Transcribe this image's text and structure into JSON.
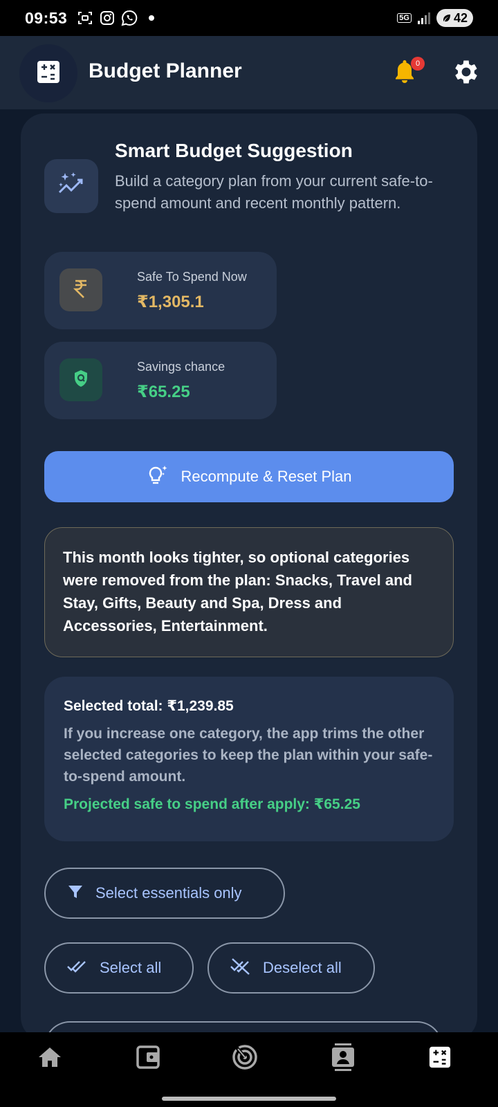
{
  "status_bar": {
    "time": "09:53",
    "network": "5G",
    "battery": "42",
    "icons": [
      "screenshot-icon",
      "instagram-icon",
      "whatsapp-icon",
      "notification-dot",
      "signal-icon",
      "battery-icon"
    ]
  },
  "header": {
    "title": "Budget Planner",
    "notification_count": "0",
    "icons": [
      "calculator-icon",
      "bell-icon",
      "gear-icon"
    ]
  },
  "suggestion": {
    "title": "Smart Budget Suggestion",
    "description": "Build a category plan from your current safe-to-spend amount and recent monthly pattern.",
    "icon": "sparkle-trend-icon"
  },
  "stats": [
    {
      "label": "Safe To Spend Now",
      "value": "₹1,305.1",
      "icon": "rupee-icon",
      "color": "#e3b864"
    },
    {
      "label": "Savings chance",
      "value": "₹65.25",
      "icon": "shield-icon",
      "color": "#46cf86"
    }
  ],
  "actions": {
    "recompute_label": "Recompute & Reset Plan",
    "select_essentials_label": "Select essentials only",
    "select_all_label": "Select all",
    "deselect_all_label": "Deselect all"
  },
  "notice": {
    "text": "This month looks tighter, so optional categories were removed from the plan: Snacks, Travel and Stay, Gifts, Beauty and Spa, Dress and Accessories, Entertainment."
  },
  "summary": {
    "total": "Selected total: ₹1,239.85",
    "description": "If you increase one category, the app trims the other selected categories to keep the plan within your safe-to-spend amount.",
    "projected": "Projected safe to spend after apply: ₹65.25"
  },
  "bottom_nav": {
    "items": [
      "home-icon",
      "wallet-icon",
      "radar-icon",
      "contacts-icon",
      "calculator-icon"
    ],
    "active": "calculator-icon"
  },
  "colors": {
    "accent": "#5c8ded",
    "amber": "#e3b864",
    "green": "#46cf86",
    "link": "#a8c4ff"
  }
}
